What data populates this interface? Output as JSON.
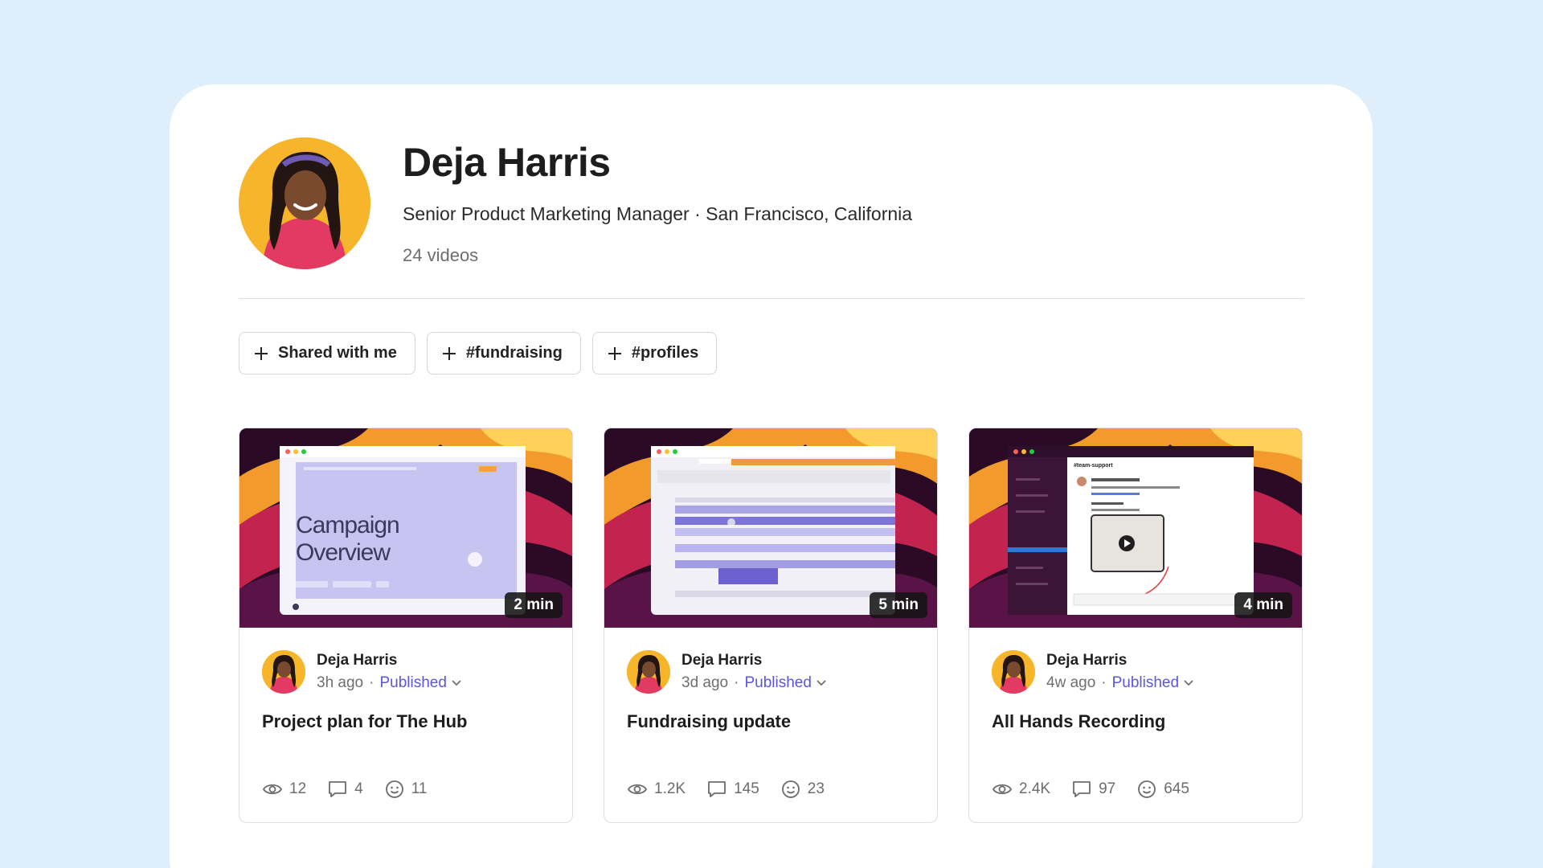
{
  "profile": {
    "name": "Deja Harris",
    "subtitle": "Senior Product Marketing Manager · San Francisco, California",
    "video_count": "24 videos"
  },
  "filters": [
    {
      "label": "Shared with me",
      "icon": "plus-icon"
    },
    {
      "label": "#fundraising",
      "icon": "plus-icon"
    },
    {
      "label": "#profiles",
      "icon": "plus-icon"
    }
  ],
  "cards": [
    {
      "duration": "2 min",
      "author": "Deja Harris",
      "time": "3h ago",
      "separator": "·",
      "status": "Published",
      "title": "Project plan for The Hub",
      "views": "12",
      "comments": "4",
      "reactions": "11",
      "thumb_text": [
        "Campaign",
        "Overview"
      ]
    },
    {
      "duration": "5 min",
      "author": "Deja Harris",
      "time": "3d ago",
      "separator": "·",
      "status": "Published",
      "title": "Fundraising update",
      "views": "1.2K",
      "comments": "145",
      "reactions": "23"
    },
    {
      "duration": "4 min",
      "author": "Deja Harris",
      "time": "4w ago",
      "separator": "·",
      "status": "Published",
      "title": "All Hands Recording",
      "views": "2.4K",
      "comments": "97",
      "reactions": "645",
      "thumb_text": [
        "#team-support"
      ]
    }
  ],
  "colors": {
    "background": "#deeefa",
    "status": "#5b55e0",
    "avatar_bg": "#f7b52c"
  }
}
